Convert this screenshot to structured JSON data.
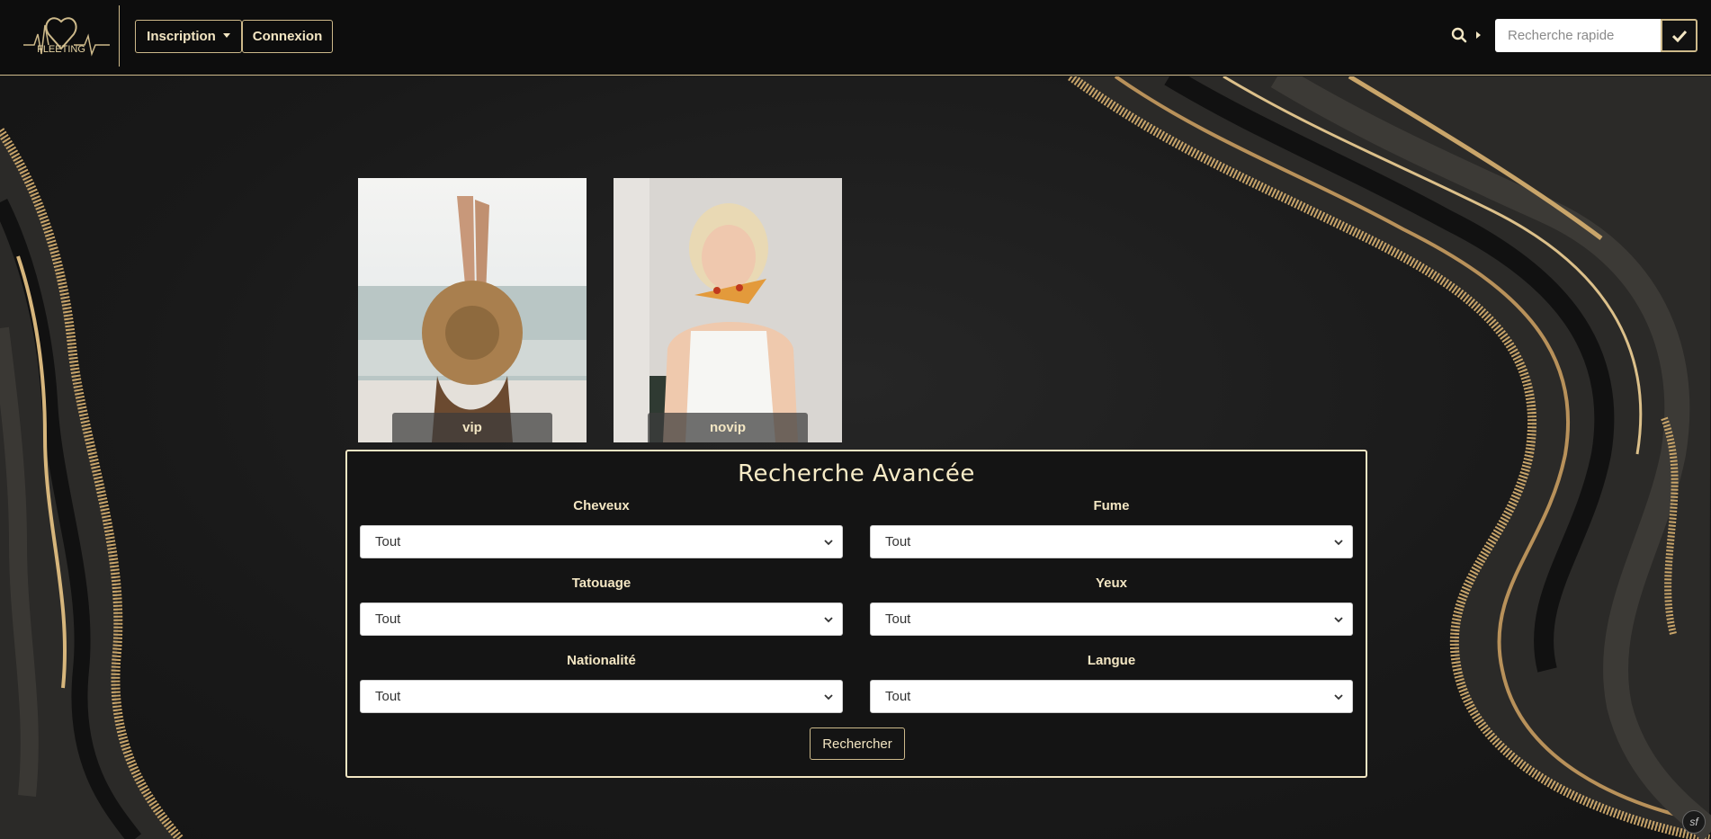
{
  "header": {
    "logo_text": "FLEETING",
    "inscription_label": "Inscription",
    "connexion_label": "Connexion",
    "quick_search_placeholder": "Recherche rapide"
  },
  "profiles": [
    {
      "label": "vip"
    },
    {
      "label": "novip"
    }
  ],
  "advanced_search": {
    "title": "Recherche Avancée",
    "fields": [
      {
        "label": "Cheveux",
        "value": "Tout"
      },
      {
        "label": "Fume",
        "value": "Tout"
      },
      {
        "label": "Tatouage",
        "value": "Tout"
      },
      {
        "label": "Yeux",
        "value": "Tout"
      },
      {
        "label": "Nationalité",
        "value": "Tout"
      },
      {
        "label": "Langue",
        "value": "Tout"
      }
    ],
    "submit_label": "Rechercher"
  },
  "colors": {
    "gold": "#cdb98a",
    "cream": "#f3e6c3",
    "navbar_bg": "#0d0d0d"
  },
  "footer": {
    "badge_text": "sf"
  }
}
